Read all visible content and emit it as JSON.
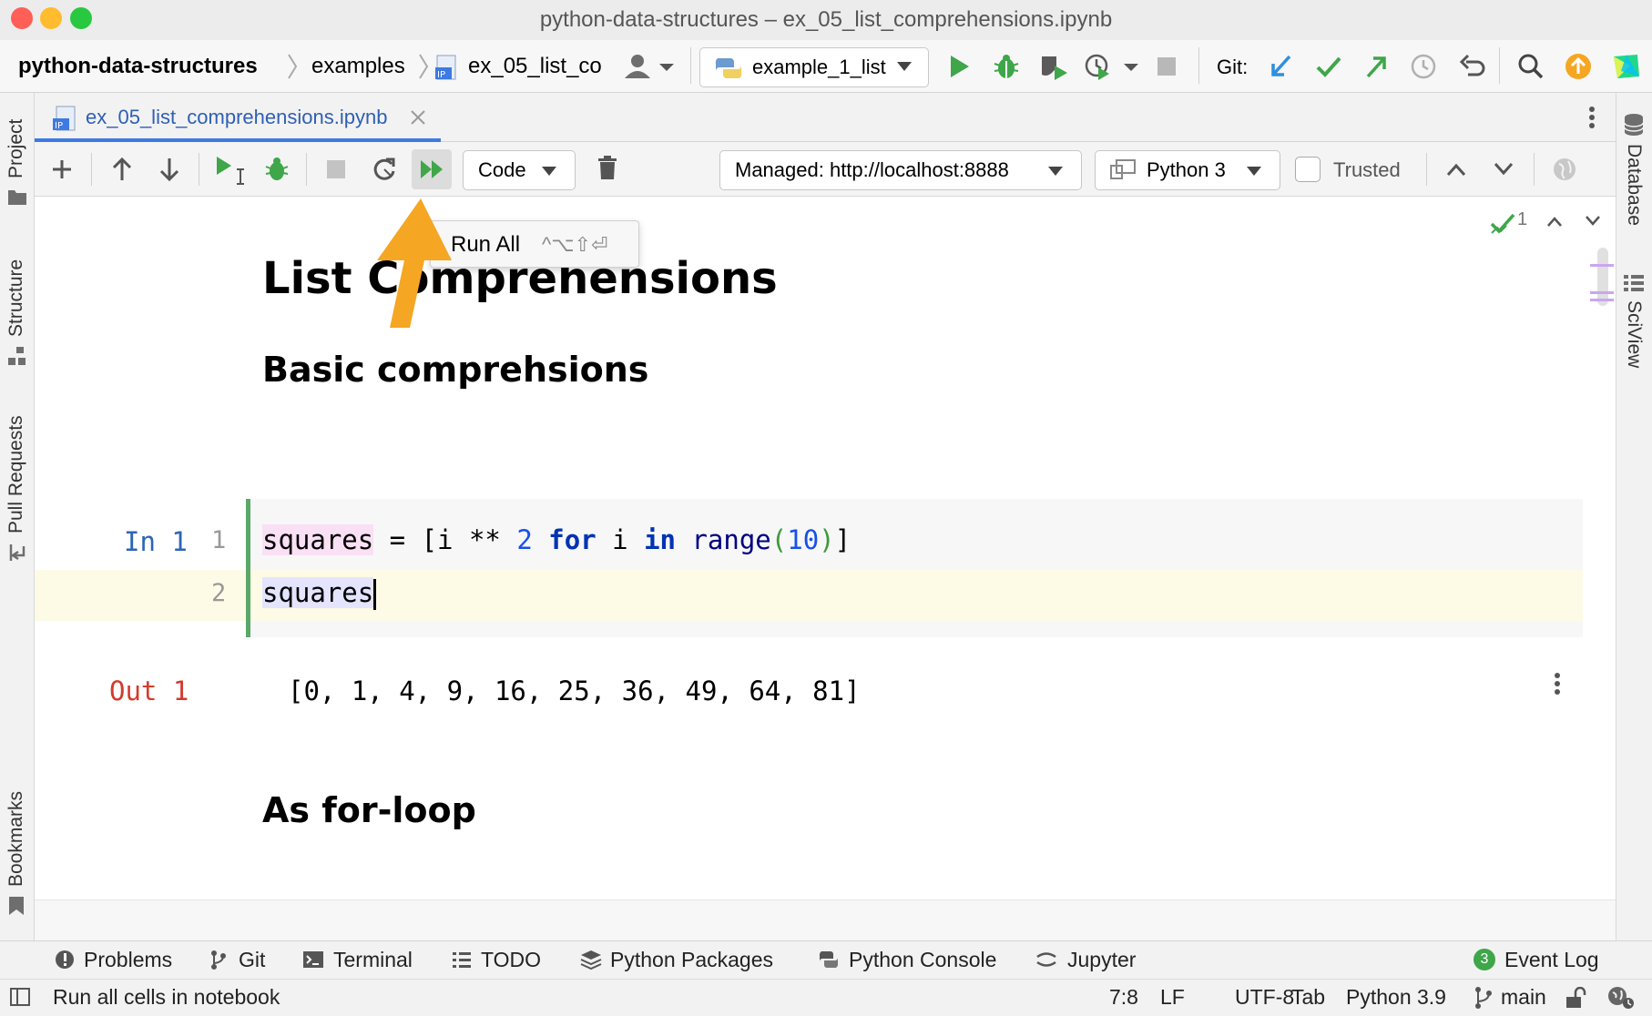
{
  "window": {
    "title": "python-data-structures – ex_05_list_comprehensions.ipynb"
  },
  "navbar": {
    "breadcrumbs": [
      "python-data-structures",
      "examples",
      "ex_05_list_co"
    ],
    "run_config": "example_1_list",
    "git_label": "Git:"
  },
  "tab": {
    "label": "ex_05_list_comprehensions.ipynb",
    "file_badge": "IP"
  },
  "notebook_toolbar": {
    "cell_type": "Code",
    "server": "Managed: http://localhost:8888",
    "kernel": "Python 3",
    "trusted_label": "Trusted"
  },
  "tooltip": {
    "label": "Run All",
    "shortcut": "^⌥⇧⏎"
  },
  "inspection": {
    "count": "1"
  },
  "notebook": {
    "heading1": "List Comprehensions",
    "heading2": "Basic comprehsions",
    "heading3": "As for-loop",
    "cell": {
      "in_label": "In 1",
      "line_numbers": [
        "1",
        "2"
      ],
      "out_label": "Out 1",
      "output": "[0, 1, 4, 9, 16, 25, 36, 49, 64, 81]",
      "line1": {
        "var": "squares",
        "op1": " = [i ** ",
        "n1": "2",
        "sp1": " ",
        "kw_for": "for",
        "mid": " i ",
        "kw_in": "in",
        "sp2": " ",
        "fn_range": "range",
        "po": "(",
        "n2": "10",
        "pc": ")",
        "close": "]"
      },
      "line2": "squares"
    }
  },
  "sidebars": {
    "left": [
      "Project",
      "Structure",
      "Pull Requests",
      "Bookmarks"
    ],
    "right": [
      "Database",
      "SciView"
    ]
  },
  "bottom_tools": {
    "items": [
      "Problems",
      "Git",
      "Terminal",
      "TODO",
      "Python Packages",
      "Python Console",
      "Jupyter"
    ],
    "event_log": "Event Log",
    "event_count": "3"
  },
  "status": {
    "message": "Run all cells in notebook",
    "position": "7:8",
    "line_sep": "LF",
    "encoding": "UTF-8",
    "indent": "Tab",
    "interpreter": "Python 3.9",
    "branch": "main"
  },
  "colors": {
    "accent": "#3d7ae4",
    "run_green": "#3fa64a",
    "arrow_orange": "#f5a623",
    "out_red": "#d43a2c",
    "cell_border": "#59a869",
    "caret_row": "#fdfae6"
  }
}
